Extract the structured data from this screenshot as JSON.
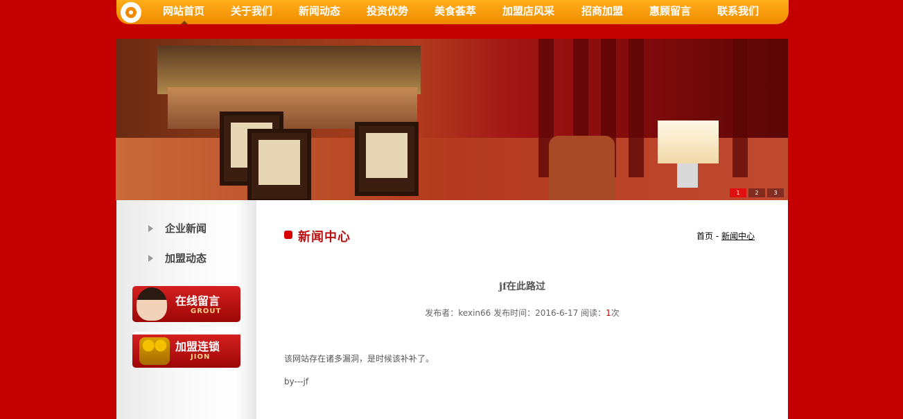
{
  "nav": {
    "items": [
      "网站首页",
      "关于我们",
      "新闻动态",
      "投资优势",
      "美食荟萃",
      "加盟店风采",
      "招商加盟",
      "惠顾留言",
      "联系我们"
    ],
    "active_index": 0
  },
  "banner": {
    "slides": [
      "1",
      "2",
      "3"
    ],
    "active_slide": 0
  },
  "sidebar": {
    "menu": [
      "企业新闻",
      "加盟动态"
    ],
    "promos": [
      {
        "title": "在线留言",
        "sub": "GROUT"
      },
      {
        "title": "加盟连锁",
        "sub": "JION"
      }
    ]
  },
  "main": {
    "section_title": "新闻中心",
    "breadcrumb": {
      "home": "首页",
      "sep": " - ",
      "current": "新闻中心"
    },
    "article": {
      "title": "jf在此路过",
      "meta": {
        "publisher_label": "发布者：",
        "publisher": "kexin66",
        "time_label": " 发布时间：",
        "time": "2016-6-17",
        "reads_label": " 阅读：",
        "reads": "1",
        "reads_unit": "次"
      },
      "body": "该网站存在诸多漏洞，是时候该补补了。",
      "signature": "by---jf"
    }
  },
  "colors": {
    "page_bg": "#c40000",
    "nav_orange": "#f08a00",
    "accent_red": "#b81010"
  }
}
